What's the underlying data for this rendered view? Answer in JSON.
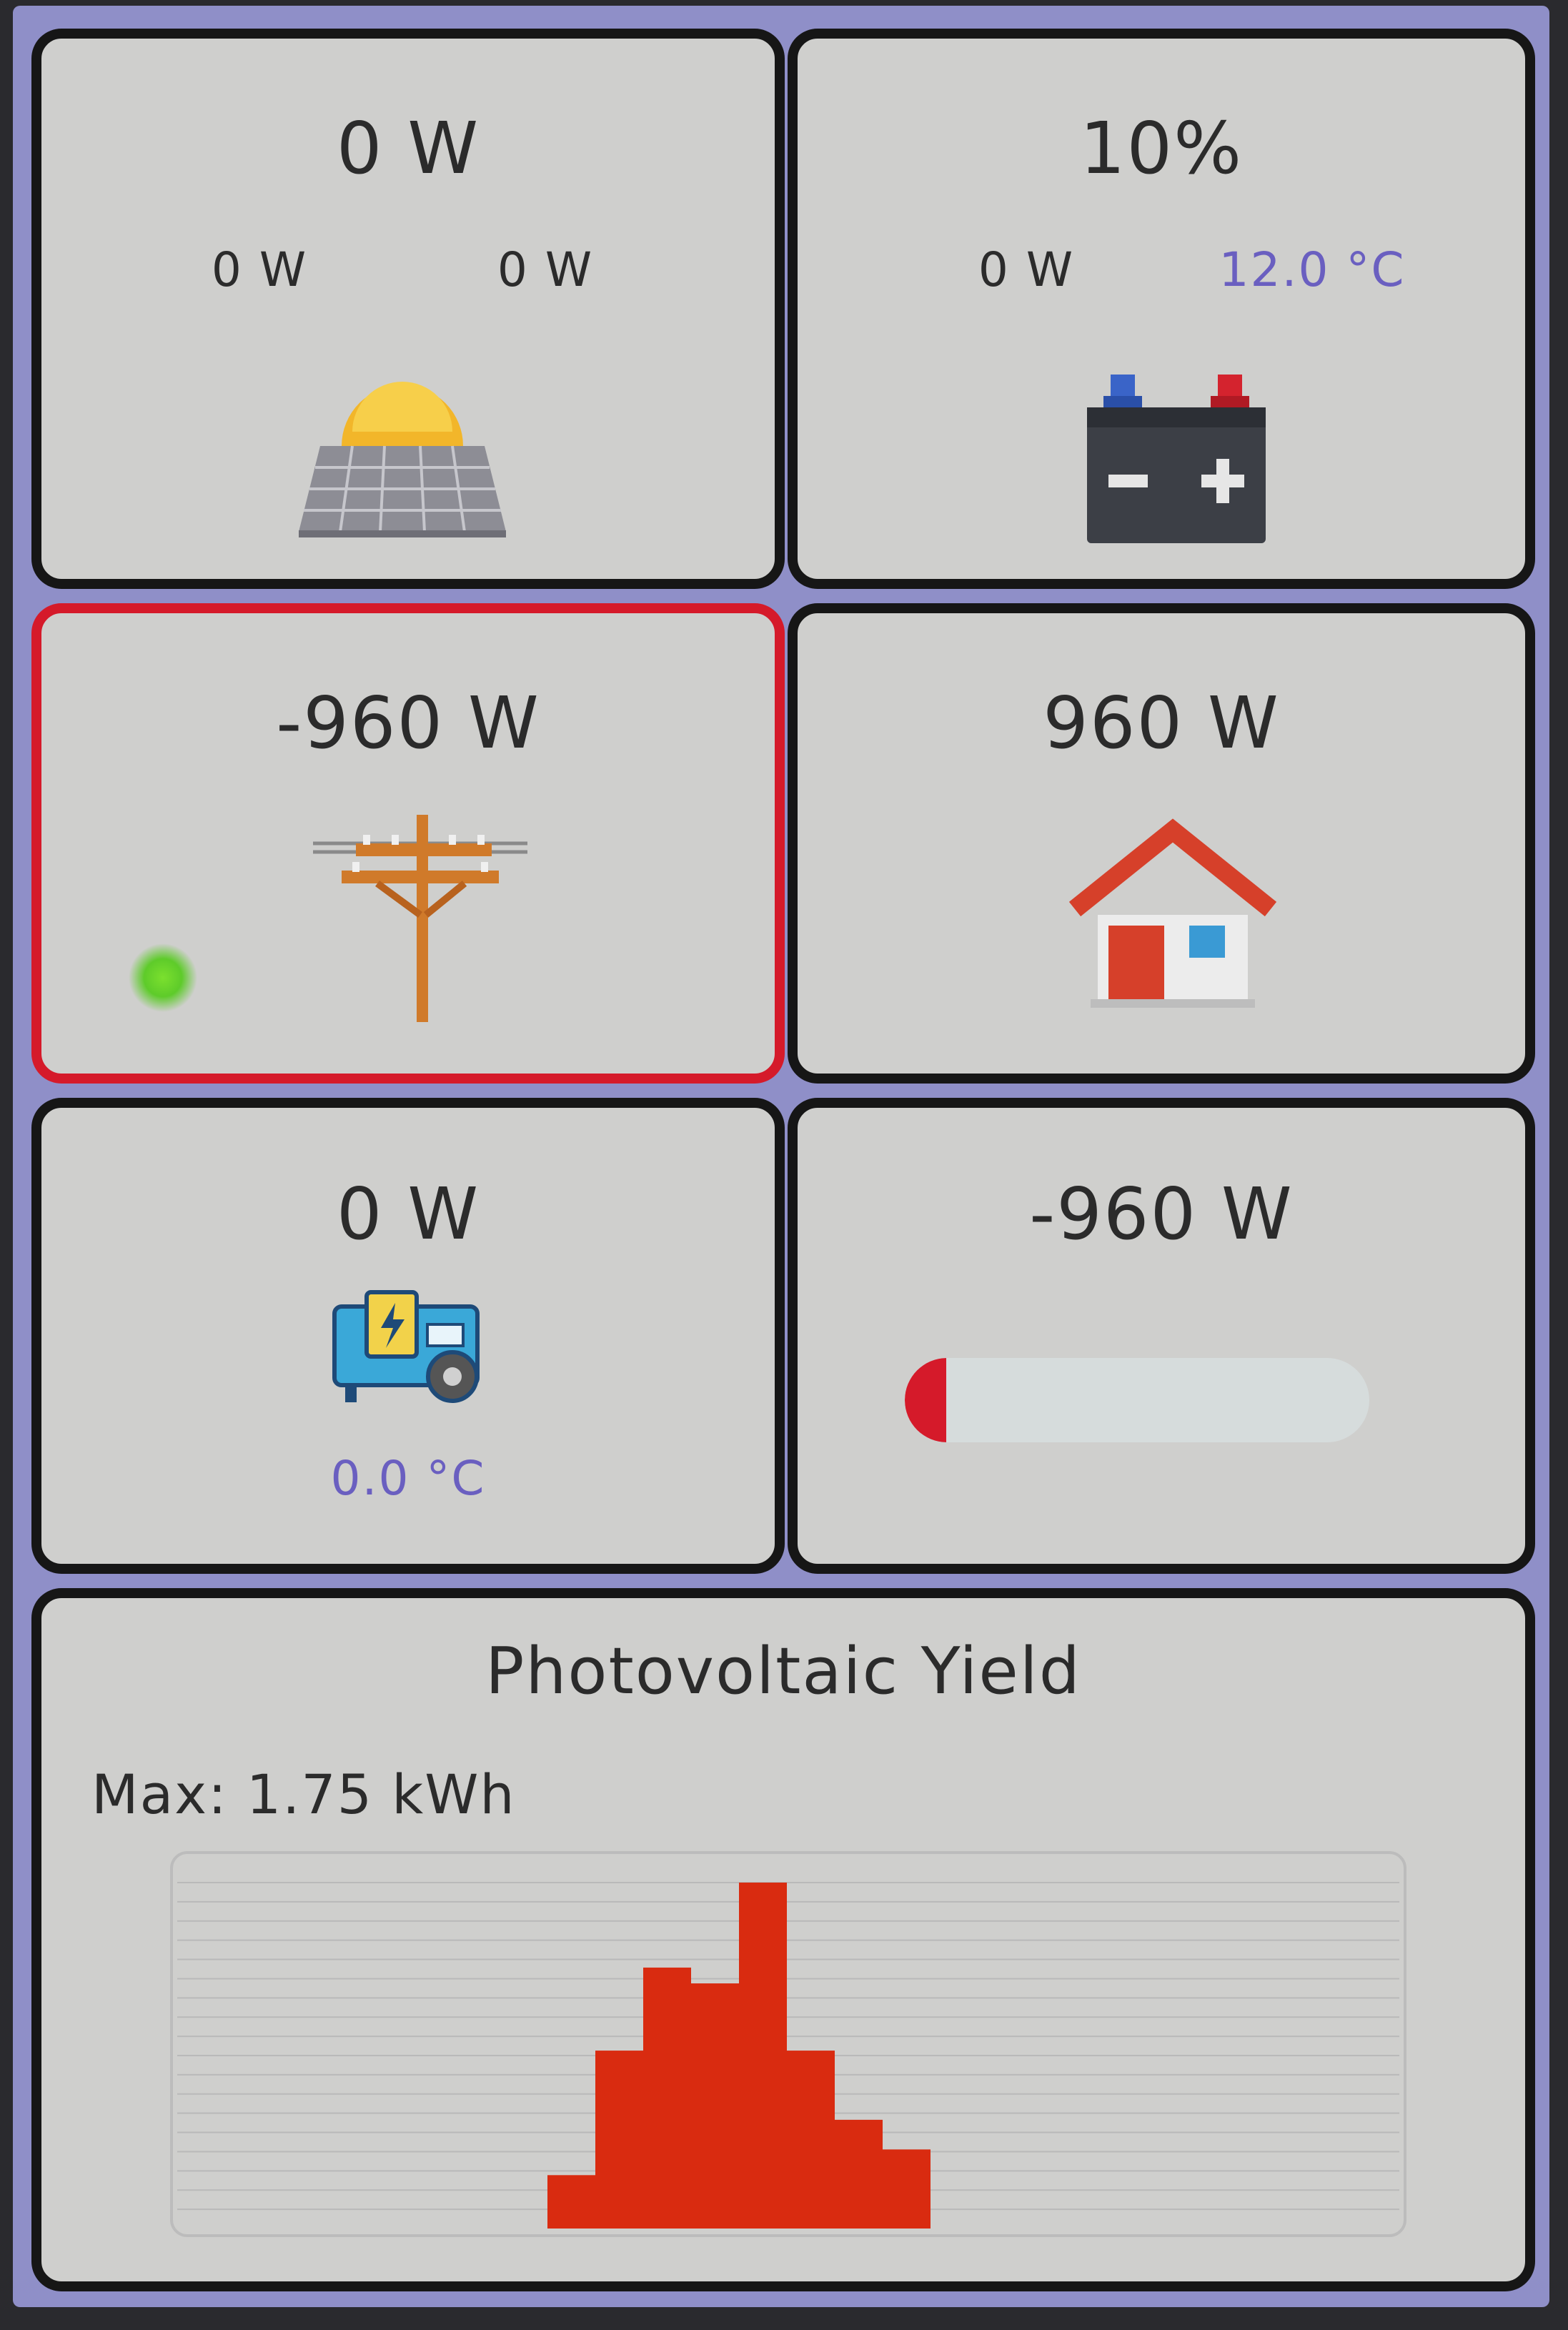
{
  "solar": {
    "total_power": "0 W",
    "string1_power": "0 W",
    "string2_power": "0 W",
    "icon": "solar-panel-icon"
  },
  "battery": {
    "soc": "10%",
    "power": "0 W",
    "temperature": "12.0 °C",
    "icon": "battery-icon"
  },
  "grid": {
    "power": "-960 W",
    "status_color": "#5ecb2a",
    "icon": "power-pole-icon",
    "border_color": "#d51a2a"
  },
  "home": {
    "power": "960 W",
    "icon": "house-icon"
  },
  "generator": {
    "power": "0 W",
    "temperature": "0.0 °C",
    "icon": "generator-icon"
  },
  "flow": {
    "power": "-960 W",
    "fill_fraction": 0.04,
    "fill_color": "#d51a2a"
  },
  "yield": {
    "title": "Photovoltaic Yield",
    "max_label": "Max: 1.75 kWh",
    "chart_data": {
      "type": "bar",
      "title": "Photovoltaic Yield",
      "ymax": 1.75,
      "ymax_unit": "kWh",
      "values": [
        0.27,
        0.9,
        1.32,
        1.24,
        1.75,
        0.9,
        0.55,
        0.4
      ],
      "bar_color": "#d92b10",
      "grid": true
    }
  }
}
